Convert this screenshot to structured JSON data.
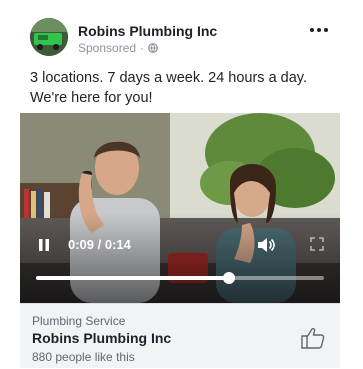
{
  "post": {
    "page_name": "Robins Plumbing Inc",
    "sponsored": "Sponsored",
    "separator": "·",
    "text": "3 locations. 7 days a week. 24 hours a day. We're here for you!",
    "more_icon": "more-horizontal-icon"
  },
  "video": {
    "time": "0:09 / 0:14",
    "progress": 0.67,
    "state": "playing",
    "icons": [
      "pause-icon",
      "volume-icon",
      "fullscreen-icon"
    ]
  },
  "footer": {
    "category": "Plumbing Service",
    "page_name": "Robins Plumbing Inc",
    "likes": "880 people like this",
    "like_icon": "thumbs-up-icon"
  },
  "colors": {
    "text": "#1d2129",
    "muted": "#8d949e",
    "footer_bg": "#f2f3f5"
  }
}
